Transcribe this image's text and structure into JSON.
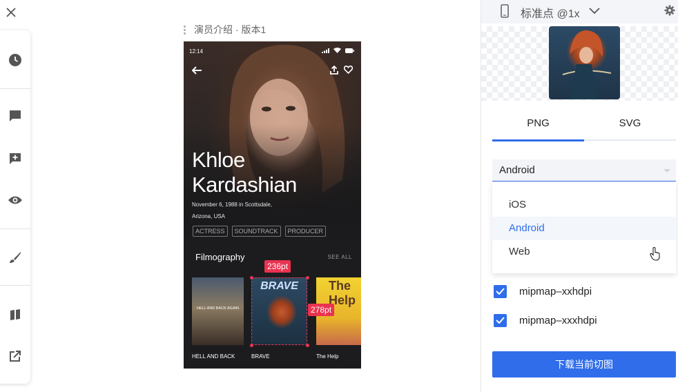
{
  "artboard": {
    "title": "演员介绍 · 版本1",
    "status_time": "12:14",
    "actor": {
      "name_line1": "Khloe",
      "name_line2": "Kardashian",
      "birth_line1": "November 6, 1988 in Scottsdale,",
      "birth_line2": "Arizona, USA",
      "roles": [
        "ACTRESS",
        "SOUNDTRACK",
        "PRODUCER"
      ]
    },
    "filmography": {
      "title": "Filmography",
      "see_all": "SEE ALL",
      "posters": [
        {
          "caption": "HELL AND BACK",
          "poster_text": "HELL AND BACK AGAIN"
        },
        {
          "caption": "BRAVE",
          "poster_text": "BRAVE"
        },
        {
          "caption": "The Help",
          "poster_text": "The Help"
        }
      ]
    },
    "measurements": {
      "width": "236pt",
      "height": "278pt"
    }
  },
  "panel": {
    "device_label": "标准点 @1x",
    "tabs": [
      "PNG",
      "SVG"
    ],
    "active_tab": "PNG",
    "select_value": "Android",
    "options": [
      "iOS",
      "Android",
      "Web"
    ],
    "selected_option": "Android",
    "checkboxes": [
      {
        "label": "mipmap–xxhdpi",
        "checked": true
      },
      {
        "label": "mipmap–xxxhdpi",
        "checked": true
      }
    ],
    "download_label": "下载当前切图"
  },
  "colors": {
    "accent": "#2f6dea",
    "measure": "#ea3350"
  },
  "icons": [
    "close-icon",
    "clock-icon",
    "comment-icon",
    "add-comment-icon",
    "eye-icon",
    "brush-icon",
    "slices-icon",
    "export-icon",
    "phone-icon",
    "chevron-down-icon",
    "gear-icon",
    "back-arrow-icon",
    "share-icon",
    "heart-icon",
    "signal-icon",
    "wifi-icon",
    "battery-icon",
    "checkbox-check-icon",
    "hand-cursor-icon"
  ]
}
